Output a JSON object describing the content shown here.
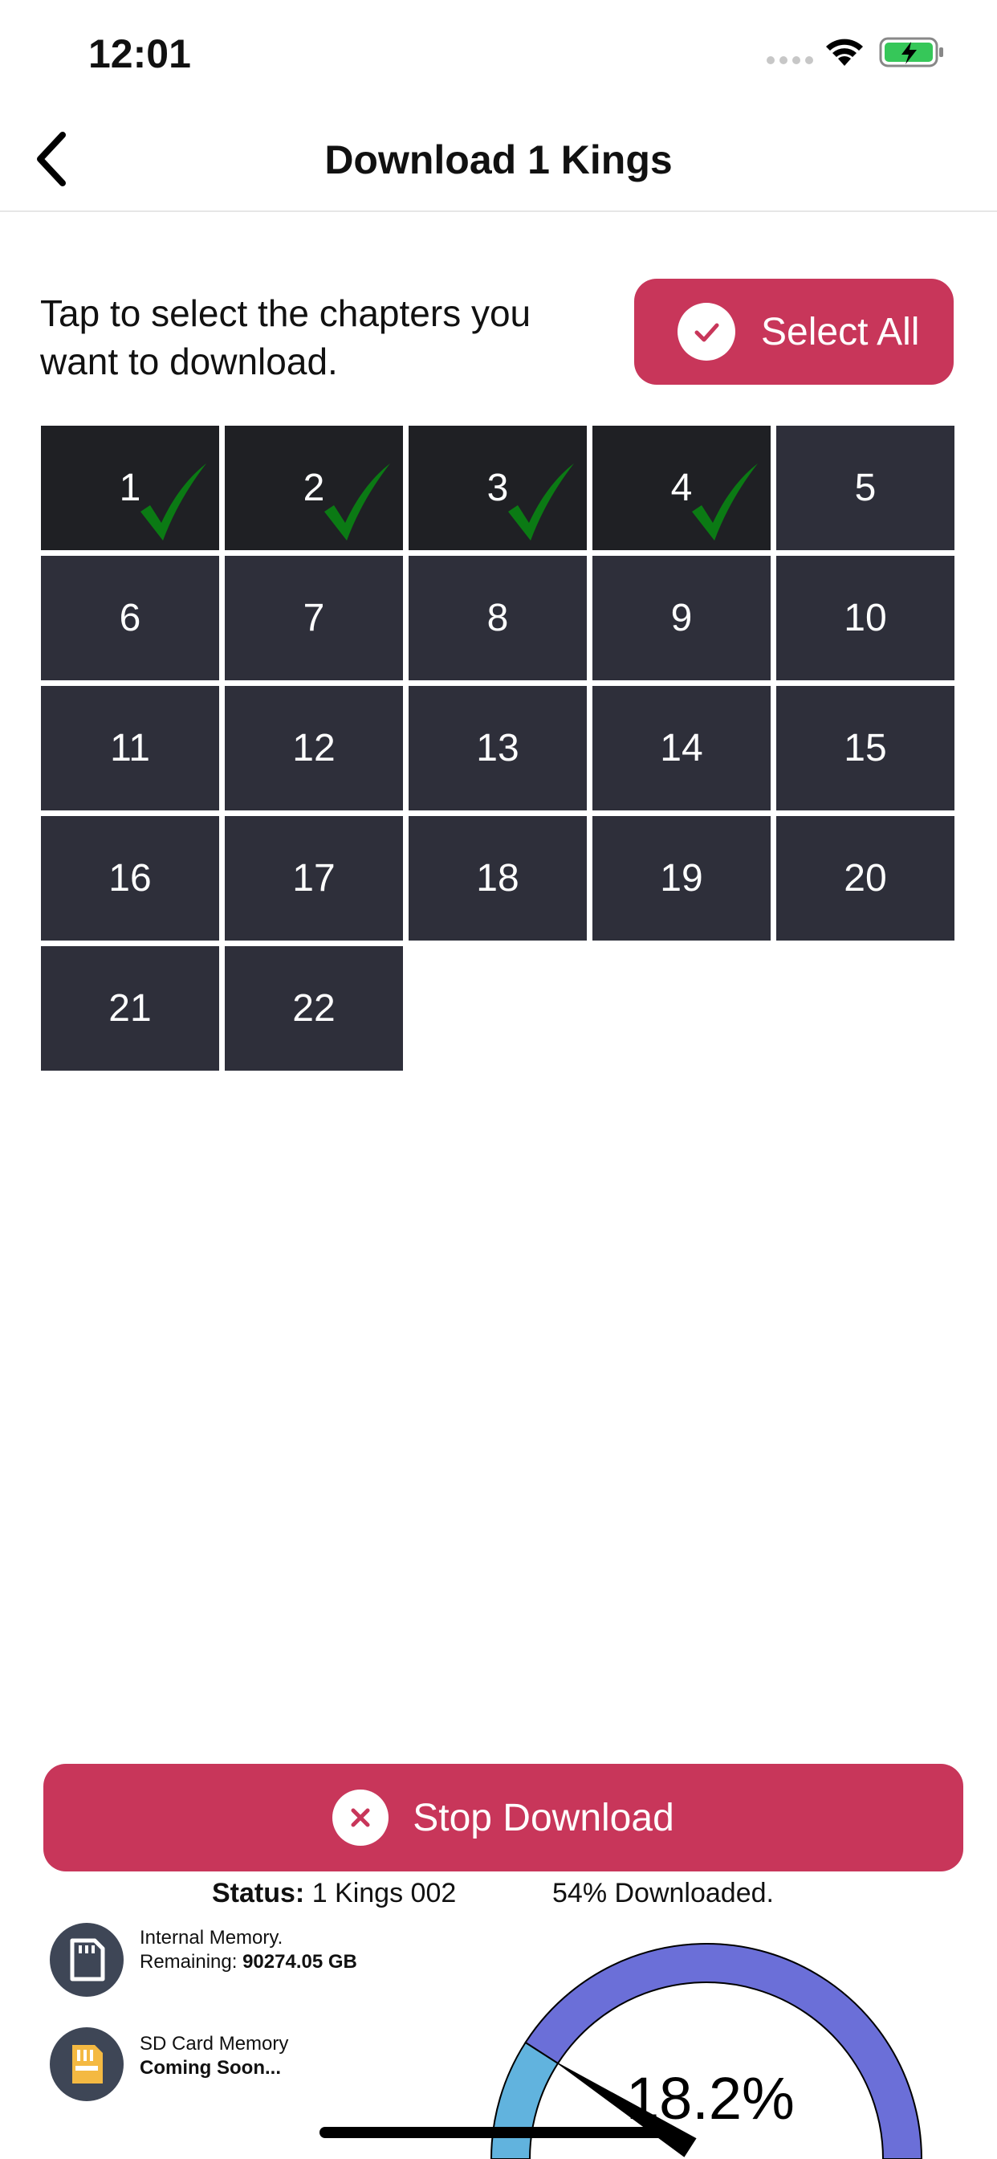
{
  "status_bar": {
    "time": "12:01"
  },
  "nav": {
    "title": "Download 1 Kings",
    "back_icon": "chevron-left-icon"
  },
  "instructions": "Tap to select the chapters you want to download.",
  "select_all": {
    "label": "Select All",
    "icon": "check-circle-icon"
  },
  "chapters": [
    {
      "num": "1",
      "selected": true
    },
    {
      "num": "2",
      "selected": true
    },
    {
      "num": "3",
      "selected": true
    },
    {
      "num": "4",
      "selected": true
    },
    {
      "num": "5",
      "selected": false
    },
    {
      "num": "6",
      "selected": false
    },
    {
      "num": "7",
      "selected": false
    },
    {
      "num": "8",
      "selected": false
    },
    {
      "num": "9",
      "selected": false
    },
    {
      "num": "10",
      "selected": false
    },
    {
      "num": "11",
      "selected": false
    },
    {
      "num": "12",
      "selected": false
    },
    {
      "num": "13",
      "selected": false
    },
    {
      "num": "14",
      "selected": false
    },
    {
      "num": "15",
      "selected": false
    },
    {
      "num": "16",
      "selected": false
    },
    {
      "num": "17",
      "selected": false
    },
    {
      "num": "18",
      "selected": false
    },
    {
      "num": "19",
      "selected": false
    },
    {
      "num": "20",
      "selected": false
    },
    {
      "num": "21",
      "selected": false
    },
    {
      "num": "22",
      "selected": false
    }
  ],
  "stop_download": {
    "label": "Stop Download",
    "icon": "close-circle-icon"
  },
  "status": {
    "prefix": "Status:",
    "value": "1 Kings 002",
    "downloaded": "54% Downloaded."
  },
  "internal_memory": {
    "label": "Internal Memory.",
    "remaining_label": "Remaining:",
    "remaining_value": "90274.05 GB",
    "icon": "sd-card-icon"
  },
  "sd_memory": {
    "label": "SD Card Memory",
    "status": "Coming Soon...",
    "icon": "sd-card-yellow-icon"
  },
  "gauge": {
    "text": "18.2%",
    "value": 0.182
  },
  "colors": {
    "accent": "#c8365a",
    "cell": "#2e2f3a",
    "cell_selected": "#1f2024",
    "check": "#0b7a14",
    "gauge_main": "#6b6fd8",
    "gauge_low": "#61b3de"
  }
}
